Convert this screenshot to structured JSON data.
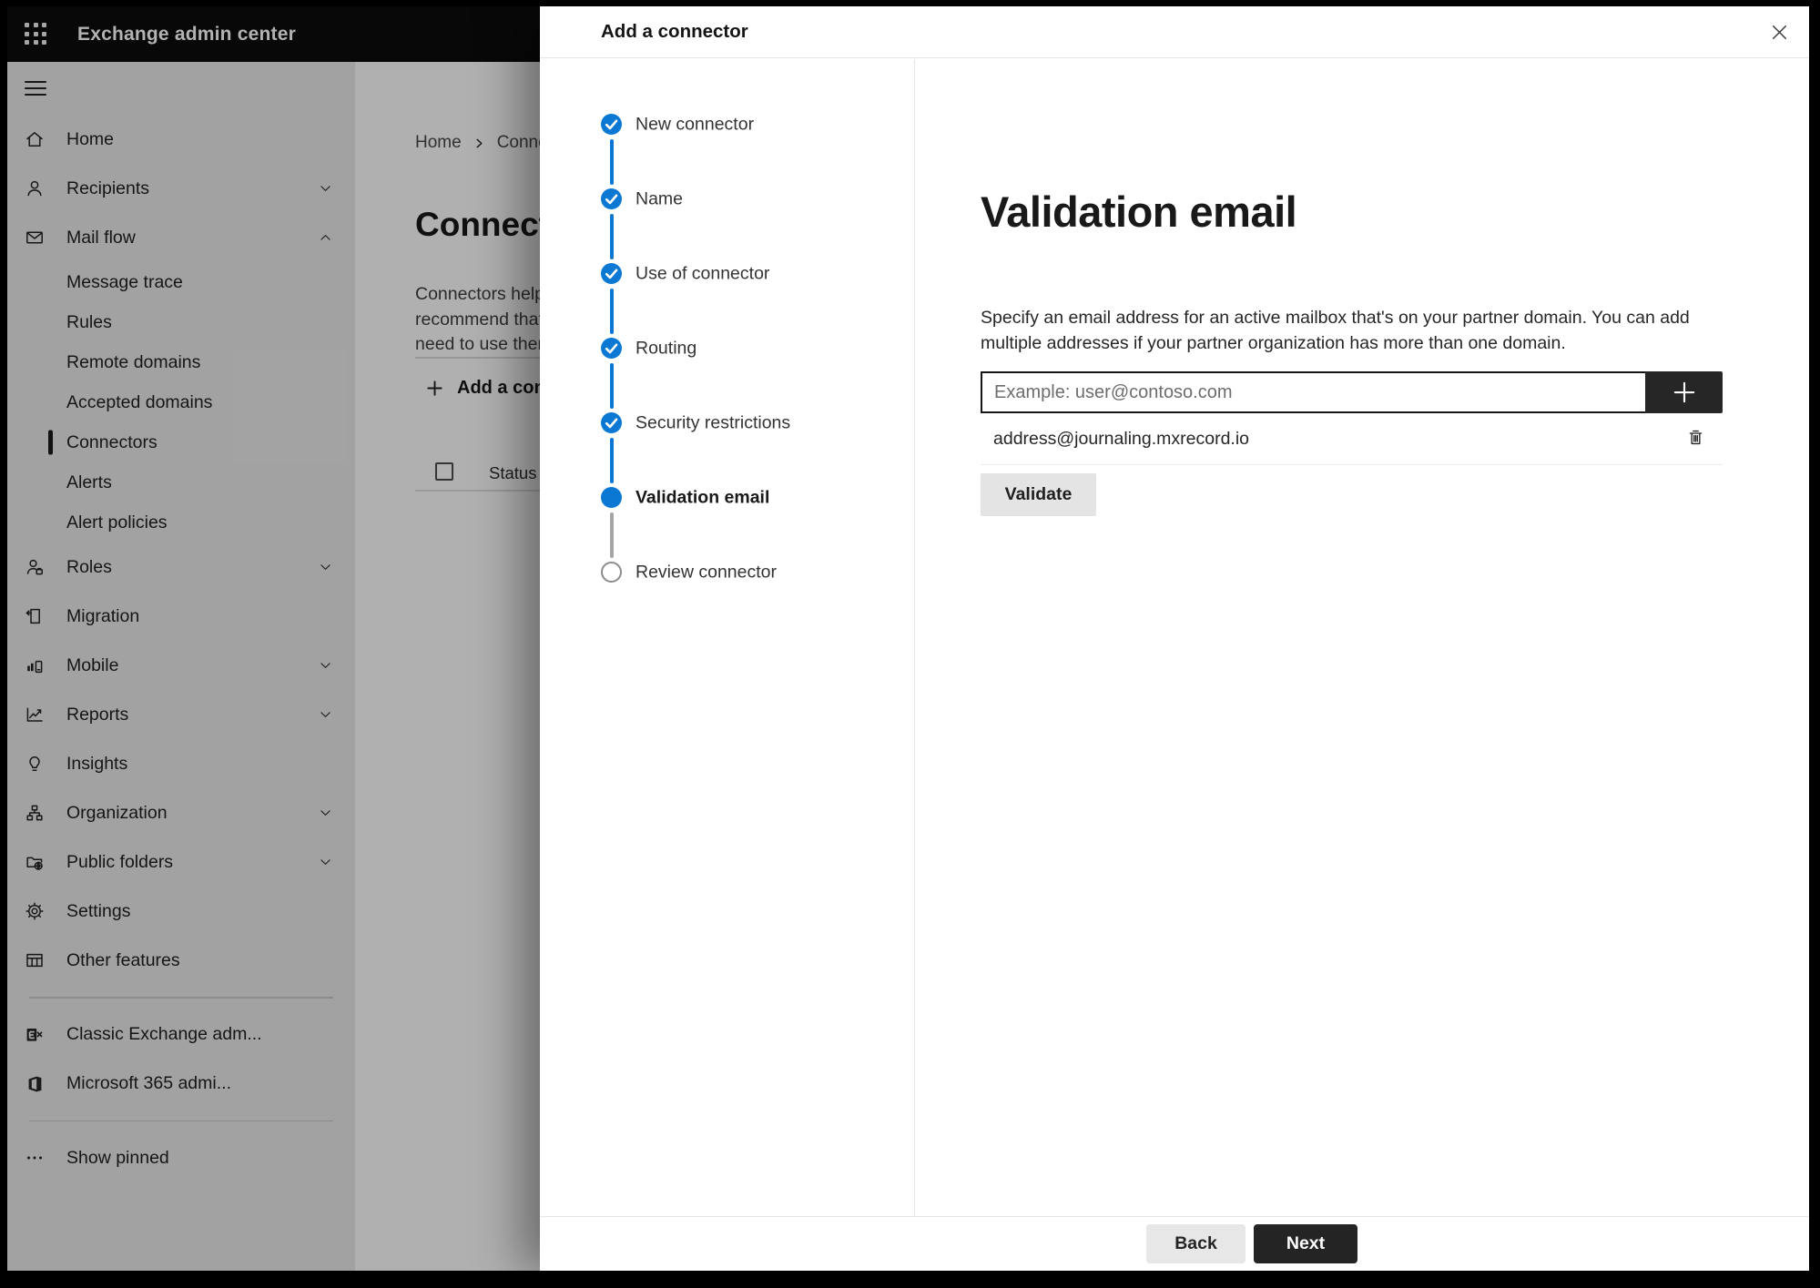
{
  "colors": {
    "accent_blue": "#0b79d4",
    "appbar_bg": "#0c0c0c",
    "next_button_bg": "#242424",
    "secondary_button_bg": "#e7e7e7",
    "upcoming_step_border": "#8c8c8c"
  },
  "appbar": {
    "title": "Exchange admin center"
  },
  "sidebar": {
    "items": [
      {
        "label": "Home",
        "icon": "home"
      },
      {
        "label": "Recipients",
        "icon": "person",
        "chevron": "down"
      },
      {
        "label": "Mail flow",
        "icon": "mail",
        "chevron": "up"
      },
      {
        "label": "Message trace",
        "child": true
      },
      {
        "label": "Rules",
        "child": true
      },
      {
        "label": "Remote domains",
        "child": true
      },
      {
        "label": "Accepted domains",
        "child": true
      },
      {
        "label": "Connectors",
        "child": true,
        "selected": true
      },
      {
        "label": "Alerts",
        "child": true
      },
      {
        "label": "Alert policies",
        "child": true
      },
      {
        "label": "Roles",
        "icon": "person-badge",
        "chevron": "down"
      },
      {
        "label": "Migration",
        "icon": "document-arrow"
      },
      {
        "label": "Mobile",
        "icon": "device-chart",
        "chevron": "down"
      },
      {
        "label": "Reports",
        "icon": "line-chart",
        "chevron": "down"
      },
      {
        "label": "Insights",
        "icon": "lightbulb"
      },
      {
        "label": "Organization",
        "icon": "org-chart",
        "chevron": "down"
      },
      {
        "label": "Public folders",
        "icon": "folder-globe",
        "chevron": "down"
      },
      {
        "label": "Settings",
        "icon": "gear"
      },
      {
        "label": "Other features",
        "icon": "table"
      },
      {
        "type": "divider"
      },
      {
        "label": "Classic Exchange adm...",
        "icon": "exchange-logo"
      },
      {
        "label": "Microsoft 365 admi...",
        "icon": "office-logo"
      },
      {
        "type": "divider"
      },
      {
        "label": "Show pinned",
        "icon": "ellipsis"
      }
    ]
  },
  "background_page": {
    "breadcrumb": {
      "home": "Home",
      "current": "Conne"
    },
    "title": "Connect",
    "intro_lines": [
      "Connectors help",
      "recommend that",
      "need to use them"
    ],
    "add_button_label": "Add a conn",
    "table": {
      "status_header": "Status"
    }
  },
  "dialog": {
    "title": "Add a connector",
    "steps": [
      {
        "label": "New connector",
        "state": "complete"
      },
      {
        "label": "Name",
        "state": "complete"
      },
      {
        "label": "Use of connector",
        "state": "complete"
      },
      {
        "label": "Routing",
        "state": "complete"
      },
      {
        "label": "Security restrictions",
        "state": "complete"
      },
      {
        "label": "Validation email",
        "state": "current"
      },
      {
        "label": "Review connector",
        "state": "upcoming"
      }
    ],
    "content": {
      "heading": "Validation email",
      "description": "Specify an email address for an active mailbox that's on your partner domain. You can add multiple addresses if your partner organization has more than one domain.",
      "email_placeholder": "Example: user@contoso.com",
      "addresses": [
        "address@journaling.mxrecord.io"
      ],
      "validate_label": "Validate"
    },
    "footer": {
      "back_label": "Back",
      "next_label": "Next"
    }
  }
}
